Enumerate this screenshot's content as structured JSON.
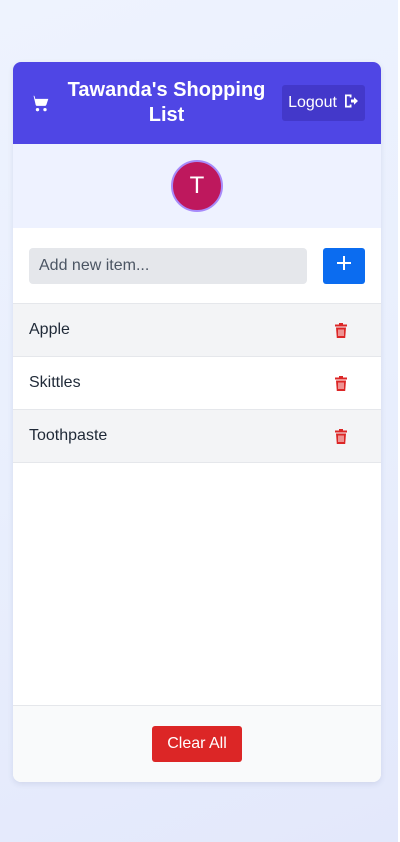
{
  "header": {
    "title": "Tawanda's Shopping List",
    "cart_icon": "shopping-cart-icon",
    "logout_label": "Logout",
    "logout_icon": "logout-icon"
  },
  "avatar": {
    "initial": "T"
  },
  "add_form": {
    "placeholder": "Add new item...",
    "value": "",
    "button_icon": "plus-icon"
  },
  "items": [
    {
      "label": "Apple"
    },
    {
      "label": "Skittles"
    },
    {
      "label": "Toothpaste"
    }
  ],
  "footer": {
    "clear_label": "Clear All"
  },
  "colors": {
    "header": "#4f46e5",
    "logout_button": "#4338ca",
    "avatar": "#be185d",
    "add_button": "#0b6cf0",
    "delete_icon": "#dc2626",
    "clear_button": "#dc2626"
  }
}
